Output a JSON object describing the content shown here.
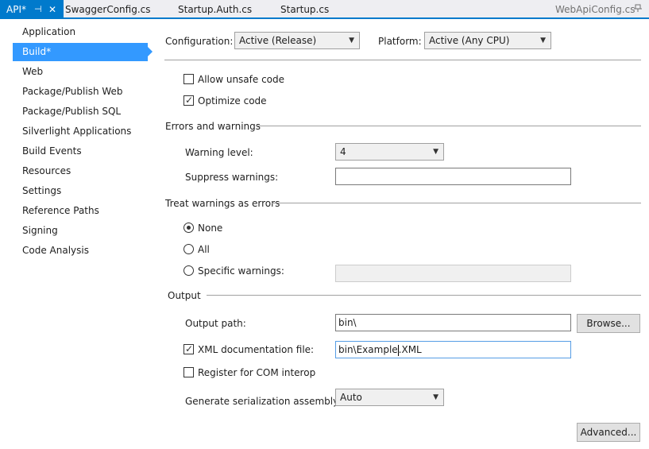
{
  "tabs": {
    "active_label": "API*",
    "active_pin": "⊣",
    "active_close": "✕",
    "items": [
      "SwaggerConfig.cs",
      "Startup.Auth.cs",
      "Startup.cs"
    ],
    "preview": "WebApiConfig.cs",
    "preview_pin_icon": "pin-icon"
  },
  "nav": {
    "items": [
      "Application",
      "Build*",
      "Web",
      "Package/Publish Web",
      "Package/Publish SQL",
      "Silverlight Applications",
      "Build Events",
      "Resources",
      "Settings",
      "Reference Paths",
      "Signing",
      "Code Analysis"
    ],
    "selected_index": 1,
    "selected_color": "#3399ff"
  },
  "header": {
    "configuration_label": "Configuration:",
    "configuration_value": "Active (Release)",
    "platform_label": "Platform:",
    "platform_value": "Active (Any CPU)"
  },
  "general": {
    "allow_unsafe_label": "Allow unsafe code",
    "allow_unsafe_checked": false,
    "optimize_label": "Optimize code",
    "optimize_checked": true
  },
  "errors": {
    "section_title": "Errors and warnings",
    "warning_level_label": "Warning level:",
    "warning_level_value": "4",
    "suppress_label": "Suppress warnings:",
    "suppress_value": ""
  },
  "treat": {
    "section_title": "Treat warnings as errors",
    "none_label": "None",
    "all_label": "All",
    "specific_label": "Specific warnings:",
    "selected": "None",
    "specific_value": ""
  },
  "output": {
    "section_title": "Output",
    "output_path_label": "Output path:",
    "output_path_value": "bin\\",
    "browse_label": "Browse...",
    "xml_doc_label": "XML documentation file:",
    "xml_doc_checked": true,
    "xml_doc_value_before_cursor": "bin\\Example",
    "xml_doc_value_after_cursor": ".XML",
    "com_interop_label": "Register for COM interop",
    "com_interop_checked": false,
    "serialization_label": "Generate serialization assembly:",
    "serialization_value": "Auto"
  },
  "advanced_label": "Advanced...",
  "colors": {
    "accent": "#007acc"
  }
}
